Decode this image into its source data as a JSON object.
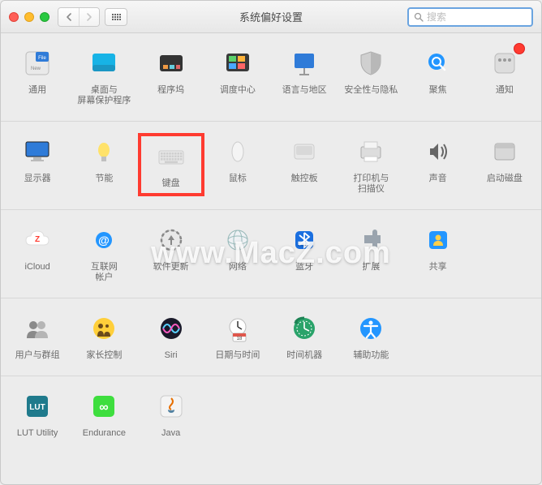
{
  "window": {
    "title": "系统偏好设置"
  },
  "search": {
    "placeholder": "搜索",
    "value": ""
  },
  "watermark": "www.MacZ.com",
  "highlight_key": "keyboard",
  "rows": [
    [
      {
        "key": "general",
        "label": "通用"
      },
      {
        "key": "desktop",
        "label": "桌面与\n屏幕保护程序"
      },
      {
        "key": "dock",
        "label": "程序坞"
      },
      {
        "key": "mission",
        "label": "调度中心"
      },
      {
        "key": "language",
        "label": "语言与地区"
      },
      {
        "key": "security",
        "label": "安全性与隐私"
      },
      {
        "key": "spotlight",
        "label": "聚焦"
      },
      {
        "key": "notifications",
        "label": "通知",
        "badge": true
      }
    ],
    [
      {
        "key": "displays",
        "label": "显示器"
      },
      {
        "key": "energy",
        "label": "节能"
      },
      {
        "key": "keyboard",
        "label": "键盘"
      },
      {
        "key": "mouse",
        "label": "鼠标"
      },
      {
        "key": "trackpad",
        "label": "触控板"
      },
      {
        "key": "printers",
        "label": "打印机与\n扫描仪"
      },
      {
        "key": "sound",
        "label": "声音"
      },
      {
        "key": "startup",
        "label": "启动磁盘"
      }
    ],
    [
      {
        "key": "icloud",
        "label": "iCloud"
      },
      {
        "key": "internet",
        "label": "互联网\n帐户"
      },
      {
        "key": "software",
        "label": "软件更新"
      },
      {
        "key": "network",
        "label": "网络"
      },
      {
        "key": "bluetooth",
        "label": "蓝牙"
      },
      {
        "key": "extensions",
        "label": "扩展"
      },
      {
        "key": "sharing",
        "label": "共享"
      }
    ],
    [
      {
        "key": "users",
        "label": "用户与群组"
      },
      {
        "key": "parental",
        "label": "家长控制"
      },
      {
        "key": "siri",
        "label": "Siri"
      },
      {
        "key": "datetime",
        "label": "日期与时间"
      },
      {
        "key": "timemachine",
        "label": "时间机器"
      },
      {
        "key": "accessibility",
        "label": "辅助功能"
      }
    ],
    [
      {
        "key": "lut",
        "label": "LUT Utility"
      },
      {
        "key": "endurance",
        "label": "Endurance"
      },
      {
        "key": "java",
        "label": "Java"
      }
    ]
  ]
}
